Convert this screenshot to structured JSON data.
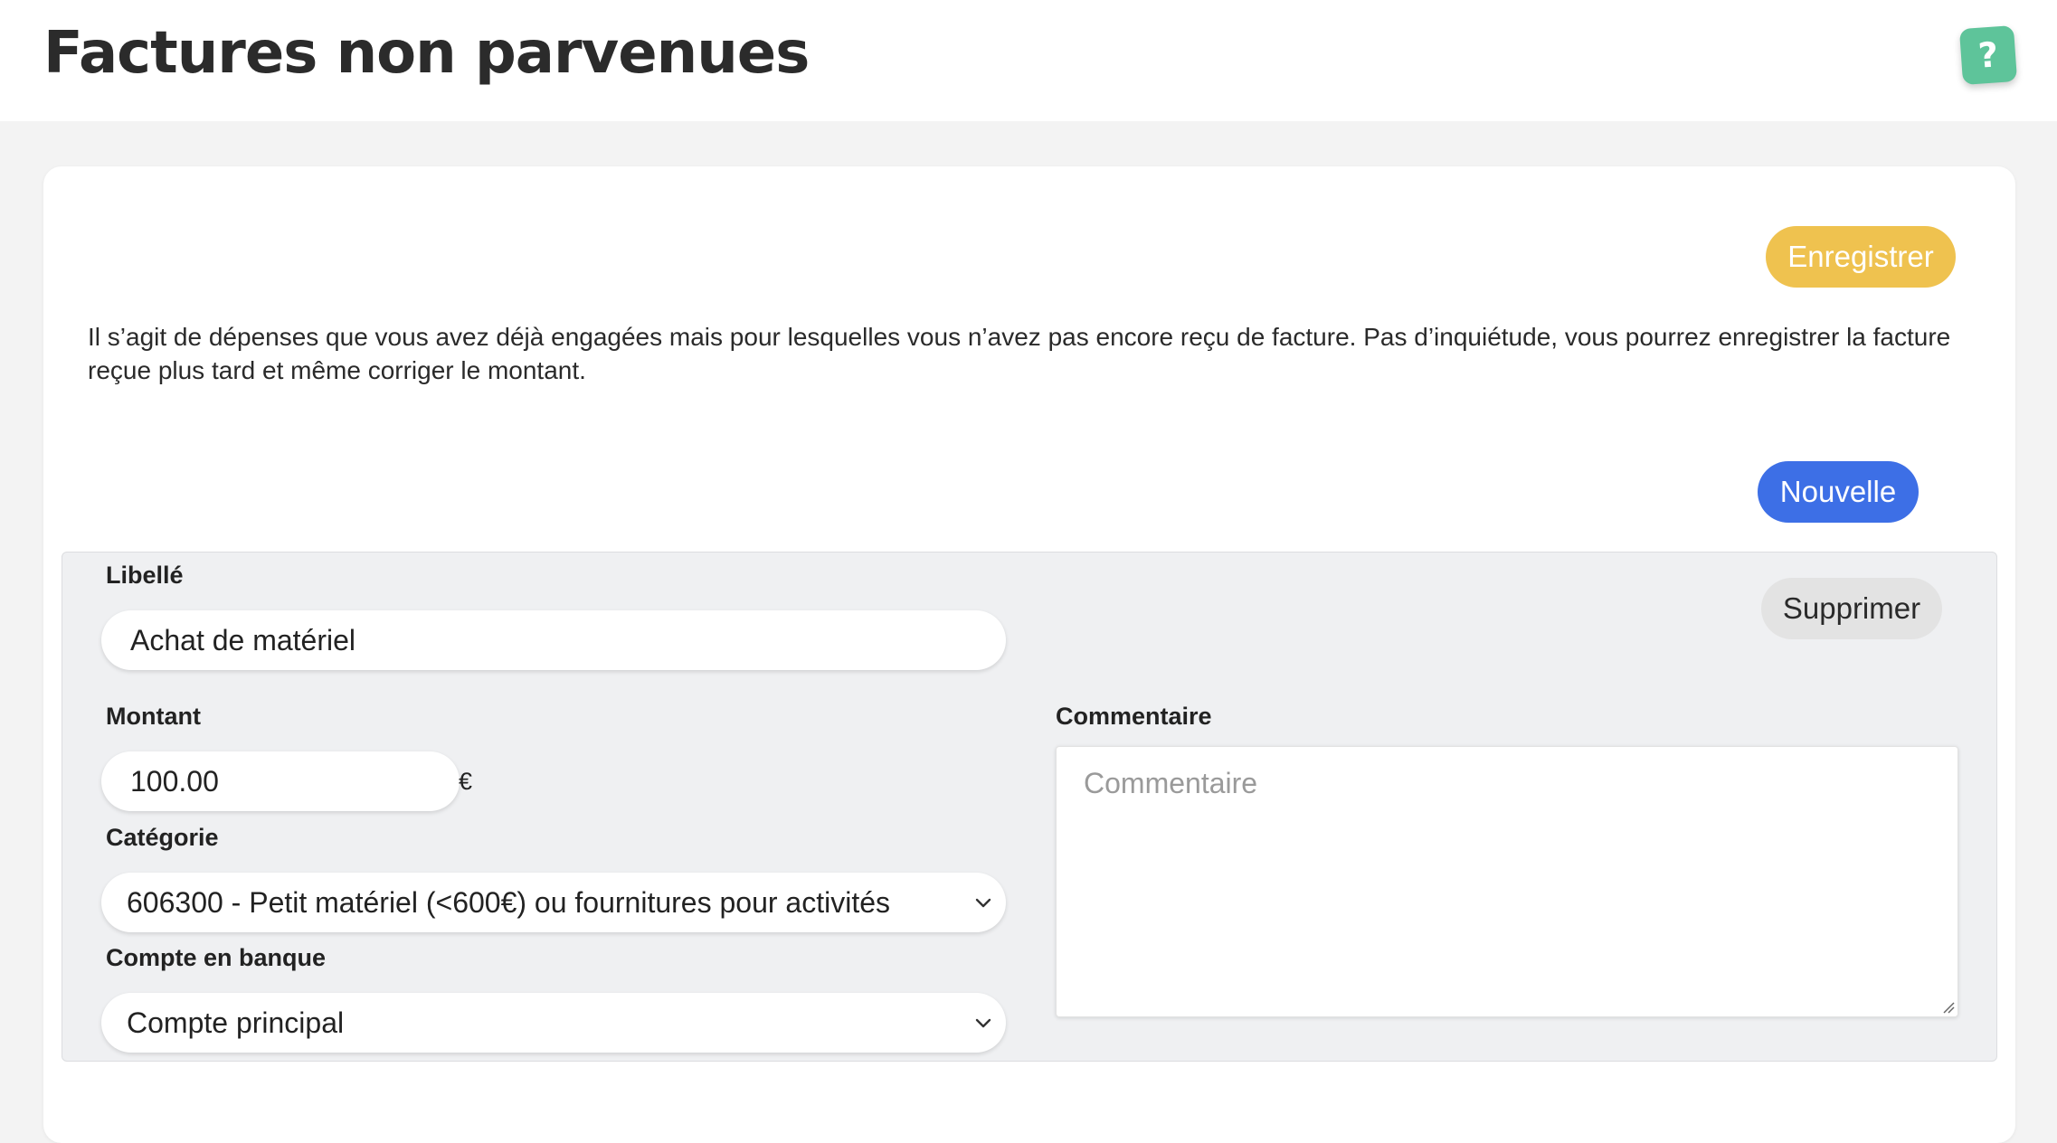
{
  "header": {
    "title": "Factures non parvenues",
    "help_label": "?"
  },
  "actions": {
    "save_label": "Enregistrer",
    "new_label": "Nouvelle"
  },
  "intro_text": "Il s’agit de dépenses que vous avez déjà engagées mais pour lesquelles vous n’avez pas encore reçu de facture. Pas d’inquiétude, vous pourrez enregistrer la facture reçue plus tard et même corriger le montant.",
  "entry": {
    "delete_label": "Supprimer",
    "libelle": {
      "label": "Libellé",
      "value": "Achat de matériel"
    },
    "montant": {
      "label": "Montant",
      "value": "100.00",
      "currency": "€"
    },
    "categorie": {
      "label": "Catégorie",
      "selected": "606300 - Petit matériel (<600€) ou fournitures pour activités"
    },
    "compte": {
      "label": "Compte en banque",
      "selected": "Compte principal"
    },
    "commentaire": {
      "label": "Commentaire",
      "placeholder": "Commentaire",
      "value": ""
    }
  },
  "colors": {
    "save_button": "#efc24f",
    "new_button": "#3d6fe6",
    "help_button": "#5ec49a",
    "page_background": "#f3f3f3",
    "entry_background": "#eff0f2"
  }
}
